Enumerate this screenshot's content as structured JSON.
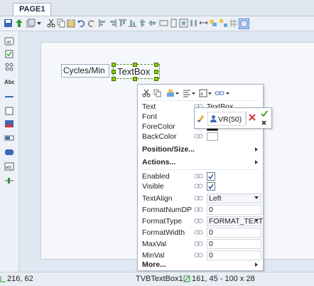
{
  "tabs": [
    {
      "label": "PAGE1"
    }
  ],
  "canvas": {
    "label_text": "Cycles/Min",
    "textbox_text": "TextBox"
  },
  "props": {
    "rows": [
      {
        "name": "Text",
        "value": "TextBox"
      },
      {
        "name": "Font",
        "value": ""
      },
      {
        "name": "ForeColor",
        "value": ""
      },
      {
        "name": "BackColor",
        "value": ""
      }
    ],
    "sections": [
      {
        "label": "Position/Size..."
      },
      {
        "label": "Actions..."
      },
      {
        "label": "More..."
      }
    ],
    "checkbox_rows": [
      {
        "name": "Enabled",
        "checked": true
      },
      {
        "name": "Visible",
        "checked": true
      }
    ],
    "text_align": {
      "name": "TextAlign",
      "value": "Left"
    },
    "format_num_dp": {
      "name": "FormatNumDP",
      "value": "0"
    },
    "format_type": {
      "name": "FormatType",
      "value": "FORMAT_TEXT"
    },
    "format_width": {
      "name": "FormatWidth",
      "value": "0"
    },
    "max_val": {
      "name": "MaxVal",
      "value": "0"
    },
    "min_val": {
      "name": "MinVal",
      "value": "0"
    }
  },
  "popup": {
    "expression": "VR(50)"
  },
  "status": {
    "coords": "216, 62",
    "selection": "TVBTextBox1",
    "selection_geom": "161, 45 - 100 x 28"
  }
}
